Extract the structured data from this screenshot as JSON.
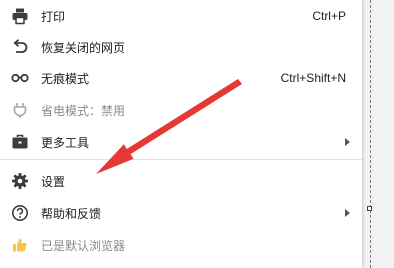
{
  "menu": {
    "items": [
      {
        "label": "打印",
        "shortcut": "Ctrl+P",
        "icon": "printer-icon"
      },
      {
        "label": "恢复关闭的网页",
        "icon": "undo-icon"
      },
      {
        "label": "无痕模式",
        "shortcut": "Ctrl+Shift+N",
        "icon": "incognito-icon"
      },
      {
        "label": "省电模式：禁用",
        "icon": "plug-icon",
        "disabled": true
      },
      {
        "label": "更多工具",
        "icon": "toolbox-icon",
        "submenu": true
      },
      {
        "label": "设置",
        "icon": "gear-icon"
      },
      {
        "label": "帮助和反馈",
        "icon": "help-icon",
        "submenu": true
      },
      {
        "label": "已是默认浏览器",
        "icon": "thumbs-up-icon",
        "disabled": true
      }
    ]
  },
  "annotation": {
    "arrow_color": "#e53935"
  }
}
